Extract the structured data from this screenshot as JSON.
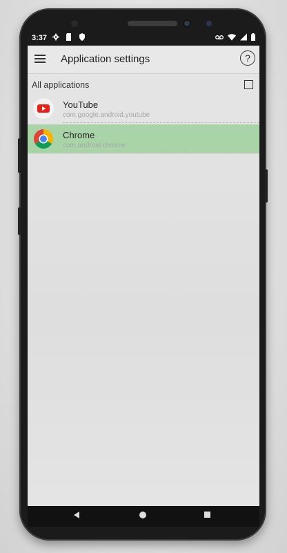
{
  "status_bar": {
    "time": "3:37",
    "icons_left": [
      "gear-icon",
      "sd-card-icon",
      "shield-icon"
    ],
    "icons_right": [
      "voicemail-icon",
      "wifi-icon",
      "signal-icon",
      "battery-icon"
    ]
  },
  "app_bar": {
    "title": "Application settings",
    "help_symbol": "?"
  },
  "section": {
    "label": "All applications",
    "checked": false
  },
  "apps": [
    {
      "name": "YouTube",
      "package": "com.google.android.youtube",
      "selected": false,
      "icon": "youtube-icon"
    },
    {
      "name": "Chrome",
      "package": "com.android.chrome",
      "selected": true,
      "icon": "chrome-icon"
    }
  ],
  "colors": {
    "selected_row": "#8fd08f",
    "youtube_red": "#e62117",
    "chrome_red": "#db4437",
    "chrome_green": "#0f9d58",
    "chrome_yellow": "#f4b400",
    "chrome_blue": "#4285f4"
  }
}
